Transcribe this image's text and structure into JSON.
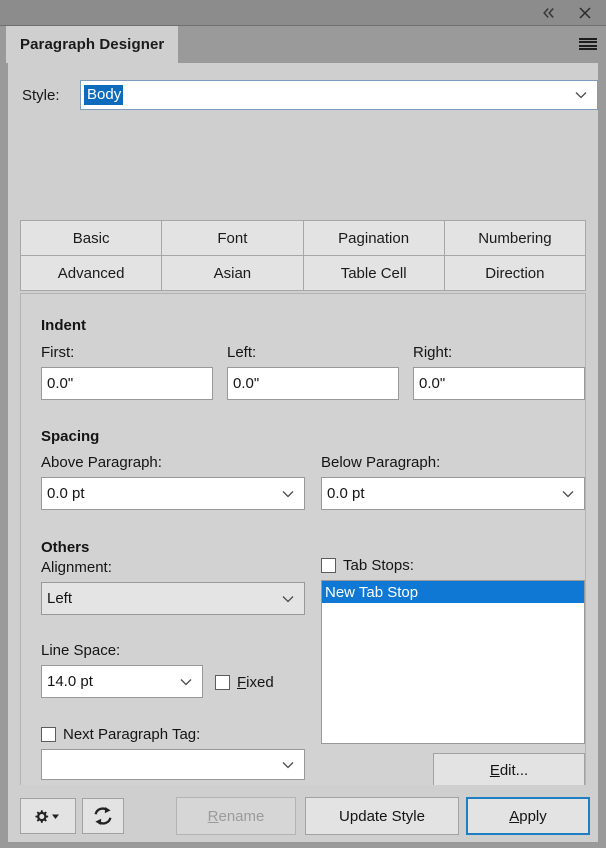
{
  "window": {
    "title_tab": "Paragraph Designer",
    "collapse_icon": "chevron-double-left-icon",
    "close_icon": "close-icon",
    "menu_icon": "hamburger-menu-icon",
    "accent_color": "#0f78d4",
    "focus_border_color": "#1f7ec2"
  },
  "style_row": {
    "label": "Style:",
    "value": "Body",
    "arrow_icon": "chevron-down-icon"
  },
  "tabs": [
    {
      "label": "Basic",
      "active": true
    },
    {
      "label": "Font",
      "active": false
    },
    {
      "label": "Pagination",
      "active": false
    },
    {
      "label": "Numbering",
      "active": false
    },
    {
      "label": "Advanced",
      "active": false
    },
    {
      "label": "Asian",
      "active": false
    },
    {
      "label": "Table Cell",
      "active": false
    },
    {
      "label": "Direction",
      "active": false
    }
  ],
  "indent": {
    "section_title": "Indent",
    "first_label": "First:",
    "first_value": "0.0\"",
    "left_label": "Left:",
    "left_value": "0.0\"",
    "right_label": "Right:",
    "right_value": "0.0\""
  },
  "spacing": {
    "section_title": "Spacing",
    "above_label": "Above Paragraph:",
    "above_value": "0.0 pt",
    "below_label": "Below Paragraph:",
    "below_value": "0.0 pt"
  },
  "others": {
    "section_title": "Others",
    "alignment_label": "Alignment:",
    "alignment_value": "Left",
    "line_space_label": "Line Space:",
    "line_space_value": "14.0 pt",
    "fixed_label": "Fixed",
    "fixed_checked": false,
    "next_tag_label": "Next Paragraph Tag:",
    "next_tag_checked": false,
    "next_tag_value": ""
  },
  "tab_stops": {
    "label": "Tab Stops:",
    "checked": false,
    "items": [
      {
        "label": "New Tab Stop",
        "selected": true
      }
    ],
    "edit_button": "Edit..."
  },
  "footer": {
    "settings_icon": "gear-dropdown-icon",
    "refresh_icon": "refresh-icon",
    "rename_label": "Rename",
    "rename_disabled": true,
    "update_style_label": "Update Style",
    "apply_label": "Apply"
  }
}
